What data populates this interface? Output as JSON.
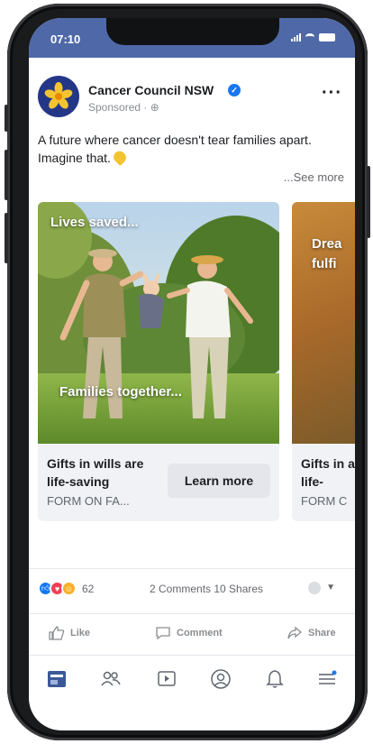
{
  "status_bar": {
    "time": "07:10"
  },
  "post": {
    "page_name": "Cancer Council NSW",
    "sponsored": "Sponsored · ⊕",
    "caption": "A future where cancer doesn't tear families apart. Imagine that.",
    "see_more": "...See more"
  },
  "carousel": [
    {
      "overlay_top": "Lives saved...",
      "overlay_bottom": "Families together...",
      "title": "Gifts in wills are life-saving",
      "subtitle": "FORM ON FA...",
      "cta": "Learn more"
    },
    {
      "overlay_top": "Drea fulfi",
      "title": "Gifts in are life-",
      "subtitle": "FORM C"
    }
  ],
  "engagement": {
    "reaction_count": "62",
    "comments_shares": "2 Comments  10 Shares"
  },
  "actions": {
    "like": "Like",
    "comment": "Comment",
    "share": "Share"
  },
  "colors": {
    "status_bar": "#4f69a8",
    "brand_blue": "#1877f2",
    "logo_navy": "#243786",
    "daffodil": "#f4c430"
  }
}
